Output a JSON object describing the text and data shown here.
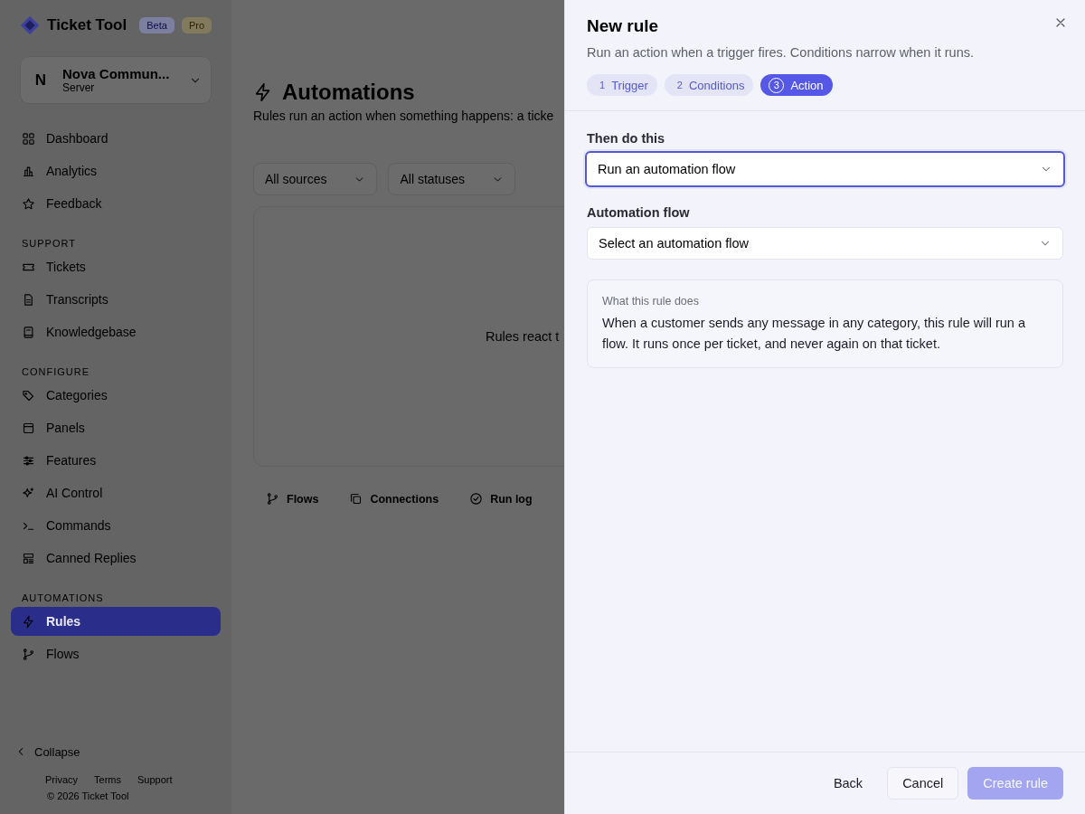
{
  "app": {
    "name": "Ticket Tool",
    "badges": [
      {
        "label": "Beta",
        "kind": "beta"
      },
      {
        "label": "Pro",
        "kind": "pro"
      }
    ]
  },
  "server": {
    "initial": "N",
    "name": "Nova Commun...",
    "type": "Server"
  },
  "sidebar": {
    "sections": [
      {
        "items": [
          {
            "label": "Dashboard",
            "selected": false
          },
          {
            "label": "Analytics",
            "selected": false
          },
          {
            "label": "Feedback",
            "selected": false
          }
        ]
      },
      {
        "title": "SUPPORT",
        "items": [
          {
            "label": "Tickets",
            "selected": false
          },
          {
            "label": "Transcripts",
            "selected": false
          },
          {
            "label": "Knowledgebase",
            "selected": false
          }
        ]
      },
      {
        "title": "CONFIGURE",
        "items": [
          {
            "label": "Categories",
            "selected": false
          },
          {
            "label": "Panels",
            "selected": false
          },
          {
            "label": "Features",
            "selected": false
          },
          {
            "label": "AI Control",
            "selected": false
          },
          {
            "label": "Commands",
            "selected": false
          },
          {
            "label": "Canned Replies",
            "selected": false
          }
        ]
      },
      {
        "title": "AUTOMATIONS",
        "items": [
          {
            "label": "Rules",
            "selected": true
          },
          {
            "label": "Flows",
            "selected": false
          }
        ]
      }
    ],
    "collapse": "Collapse",
    "footer_links": [
      "Privacy",
      "Terms",
      "Support"
    ],
    "copyright": "© 2026 Ticket Tool"
  },
  "page": {
    "title": "Automations",
    "subtitle": "Rules run an action when something happens: a ticke",
    "filters": [
      "All sources",
      "All statuses"
    ],
    "empty_text": "Rules react t",
    "tabs": [
      {
        "label": "Flows",
        "selected": false
      },
      {
        "label": "Connections",
        "selected": false
      },
      {
        "label": "Run log",
        "selected": false
      }
    ]
  },
  "drawer": {
    "title": "New rule",
    "subtitle": "Run an action when a trigger fires. Conditions narrow when it runs.",
    "steps": [
      {
        "number": "1",
        "label": "Trigger",
        "selected": false
      },
      {
        "number": "2",
        "label": "Conditions",
        "selected": false
      },
      {
        "number": "3",
        "label": "Action",
        "selected": true
      }
    ],
    "fields": [
      {
        "label": "Then do this",
        "value": "Run an automation flow",
        "focused": true
      },
      {
        "label": "Automation flow",
        "placeholder": "Select an automation flow",
        "focused": false
      }
    ],
    "summary": {
      "title": "What this rule does",
      "text": "When a customer sends any message in any category, this rule will run a flow. It runs once per ticket, and never again on that ticket."
    },
    "buttons": [
      {
        "label": "Back",
        "kind": "ghost",
        "disabled": false
      },
      {
        "label": "Cancel",
        "kind": "outline",
        "disabled": false
      },
      {
        "label": "Create rule",
        "kind": "primary",
        "disabled": true
      }
    ]
  }
}
